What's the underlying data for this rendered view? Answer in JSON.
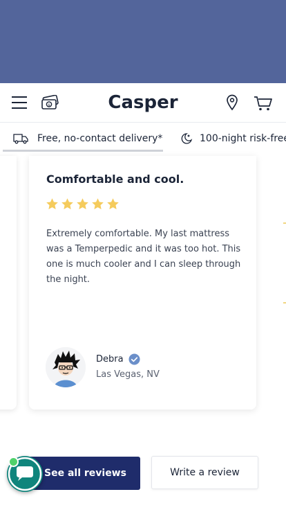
{
  "header": {
    "logo": "Casper",
    "icons": {
      "menu": "hamburger-menu-icon",
      "money": "money-icon",
      "location": "location-pin-icon",
      "cart": "shopping-cart-icon"
    }
  },
  "promo": {
    "items": [
      {
        "icon": "delivery-truck-icon",
        "label": "Free, no-contact delivery*"
      },
      {
        "icon": "moon-icon",
        "label": "100-night risk-free"
      }
    ]
  },
  "review": {
    "title": "Comfortable and cool.",
    "rating": 5,
    "rating_max": 5,
    "text": "Extremely comfortable. My last mattress was a Temperpedic and it was too hot. This one is much cooler and I can sleep through the night.",
    "reviewer_name": "Debra",
    "reviewer_location": "Las Vegas, NV",
    "verified": true
  },
  "actions": {
    "see_all": "See all reviews",
    "write": "Write a review"
  },
  "colors": {
    "banner": "#53659b",
    "primary": "#1f2c6b",
    "star": "#f5cb5c",
    "chat": "#10857c"
  }
}
